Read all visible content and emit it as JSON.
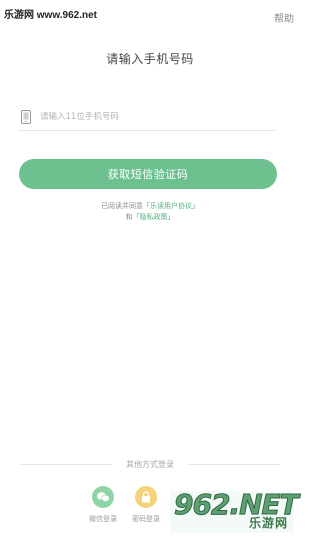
{
  "watermark": {
    "text": "乐游网 www.962.net"
  },
  "header": {
    "help_label": "帮助"
  },
  "main": {
    "title": "请输入手机号码",
    "phone_placeholder": "请输入11位手机号码",
    "sms_button_label": "获取短信验证码",
    "agreement": {
      "prefix": "已阅读并同意",
      "link1": "「乐读用户协议」",
      "conjunction": "和",
      "link2": "「隐私政策」"
    }
  },
  "other_login": {
    "divider_text": "其他方式登录",
    "options": [
      {
        "label": "微信登录",
        "icon": "wechat-icon",
        "color": "#8fd4a6"
      },
      {
        "label": "密码登录",
        "icon": "lock-icon",
        "color": "#f3d27a"
      }
    ]
  },
  "site_logo": {
    "text": "962.NET",
    "sub": "乐游网"
  },
  "colors": {
    "accent": "#6cc18e",
    "link": "#55b07c"
  }
}
